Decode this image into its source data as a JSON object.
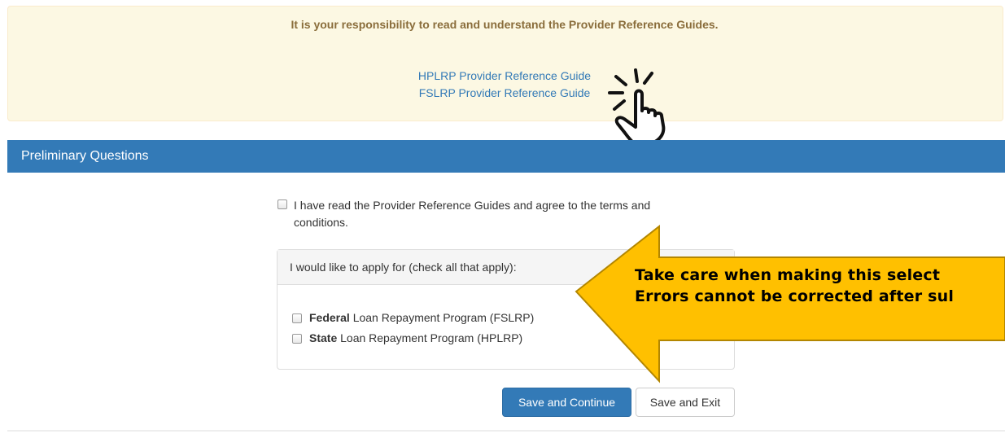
{
  "notice": {
    "text": "It is your responsibility to read and understand the Provider Reference Guides.",
    "links": [
      "HPLRP Provider Reference Guide",
      "FSLRP Provider Reference Guide"
    ]
  },
  "panel": {
    "title": "Preliminary Questions"
  },
  "agree": {
    "checked": false,
    "label": "I have read the Provider Reference Guides and agree to the terms and conditions."
  },
  "apply": {
    "heading": "I would like to apply for (check all that apply):",
    "options": [
      {
        "bold": "Federal",
        "rest": " Loan Repayment Program (FSLRP)",
        "checked": false
      },
      {
        "bold": "State",
        "rest": " Loan Repayment Program (HPLRP)",
        "checked": false
      }
    ]
  },
  "buttons": {
    "save_continue": "Save and Continue",
    "save_exit": "Save and Exit"
  },
  "callout": {
    "line1": "Take care when making this select",
    "line2": "Errors cannot be corrected after sul"
  },
  "colors": {
    "primary": "#337ab7",
    "notice_bg": "#fcf8e3",
    "notice_text": "#8a6d3b",
    "callout_fill": "#ffc000",
    "callout_stroke": "#b38600"
  },
  "icons": [
    "click-hand-icon",
    "arrow-callout-icon"
  ]
}
